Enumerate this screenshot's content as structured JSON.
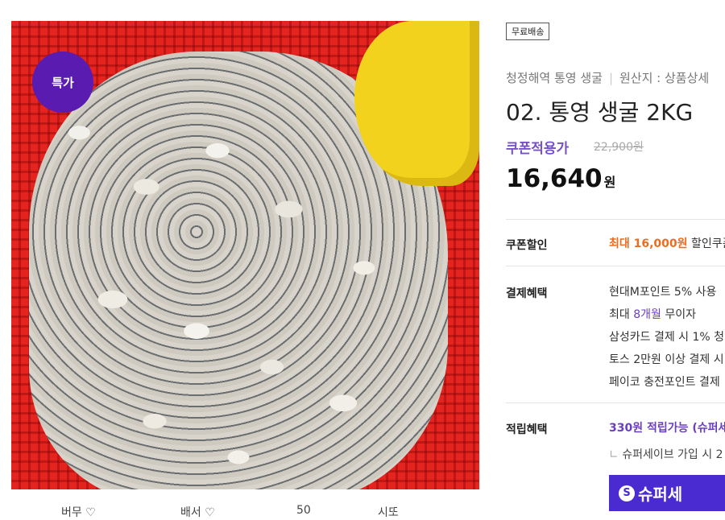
{
  "badge": "특가",
  "tag": "무료배송",
  "subtitle": {
    "left": "청정해역 통영 생굴",
    "right": "원산지 : 상품상세"
  },
  "title": "02. 통영 생굴 2KG",
  "price": {
    "coupon_label": "쿠폰적용가",
    "original": "22,900원",
    "current": "16,640",
    "unit": "원"
  },
  "coupon": {
    "label": "쿠폰할인",
    "highlight": "최대 16,000원",
    "text": "할인쿠폰"
  },
  "payment": {
    "label": "결제혜택",
    "lines": [
      "현대M포인트 5% 사용",
      "최대 8개월 무이자",
      "삼성카드 결제 시 1% 청",
      "토스 2만원 이상 결제 시",
      "페이코 충전포인트 결제"
    ],
    "installment_prefix": "최대 ",
    "installment_highlight": "8개월",
    "installment_suffix": " 무이자"
  },
  "reward": {
    "label": "적립혜택",
    "highlight": "330원 적립가능 (슈퍼세",
    "note": "슈퍼세이브 가입 시 2",
    "button": "슈퍼세"
  },
  "bottom_strip": [
    "버무 ♡",
    "배서 ♡",
    "50 ",
    "시또"
  ]
}
